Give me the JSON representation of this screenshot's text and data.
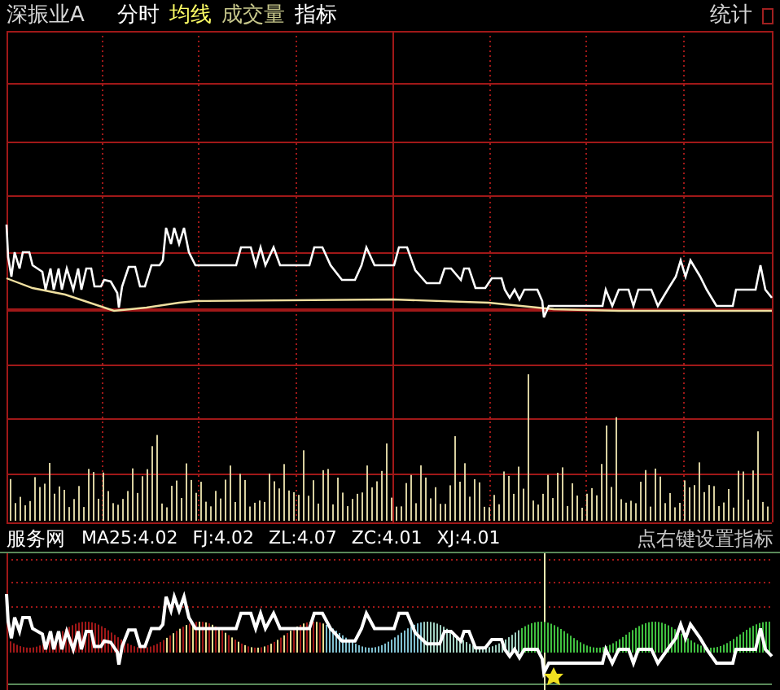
{
  "header": {
    "stock_name": "深振业A",
    "tabs": [
      {
        "label": "分时",
        "color": "#ffffff"
      },
      {
        "label": "均线",
        "color": "#ffff66"
      },
      {
        "label": "成交量",
        "color": "#c8c88c"
      },
      {
        "label": "指标",
        "color": "#ffffff"
      }
    ],
    "right_label": "统计"
  },
  "indicator": {
    "name": "服务网",
    "values": [
      "MA25:4.02",
      "FJ:4.02",
      "ZL:4.07",
      "ZC:4.01",
      "XJ:4.01"
    ],
    "hint": "点右键设置指标"
  }
}
